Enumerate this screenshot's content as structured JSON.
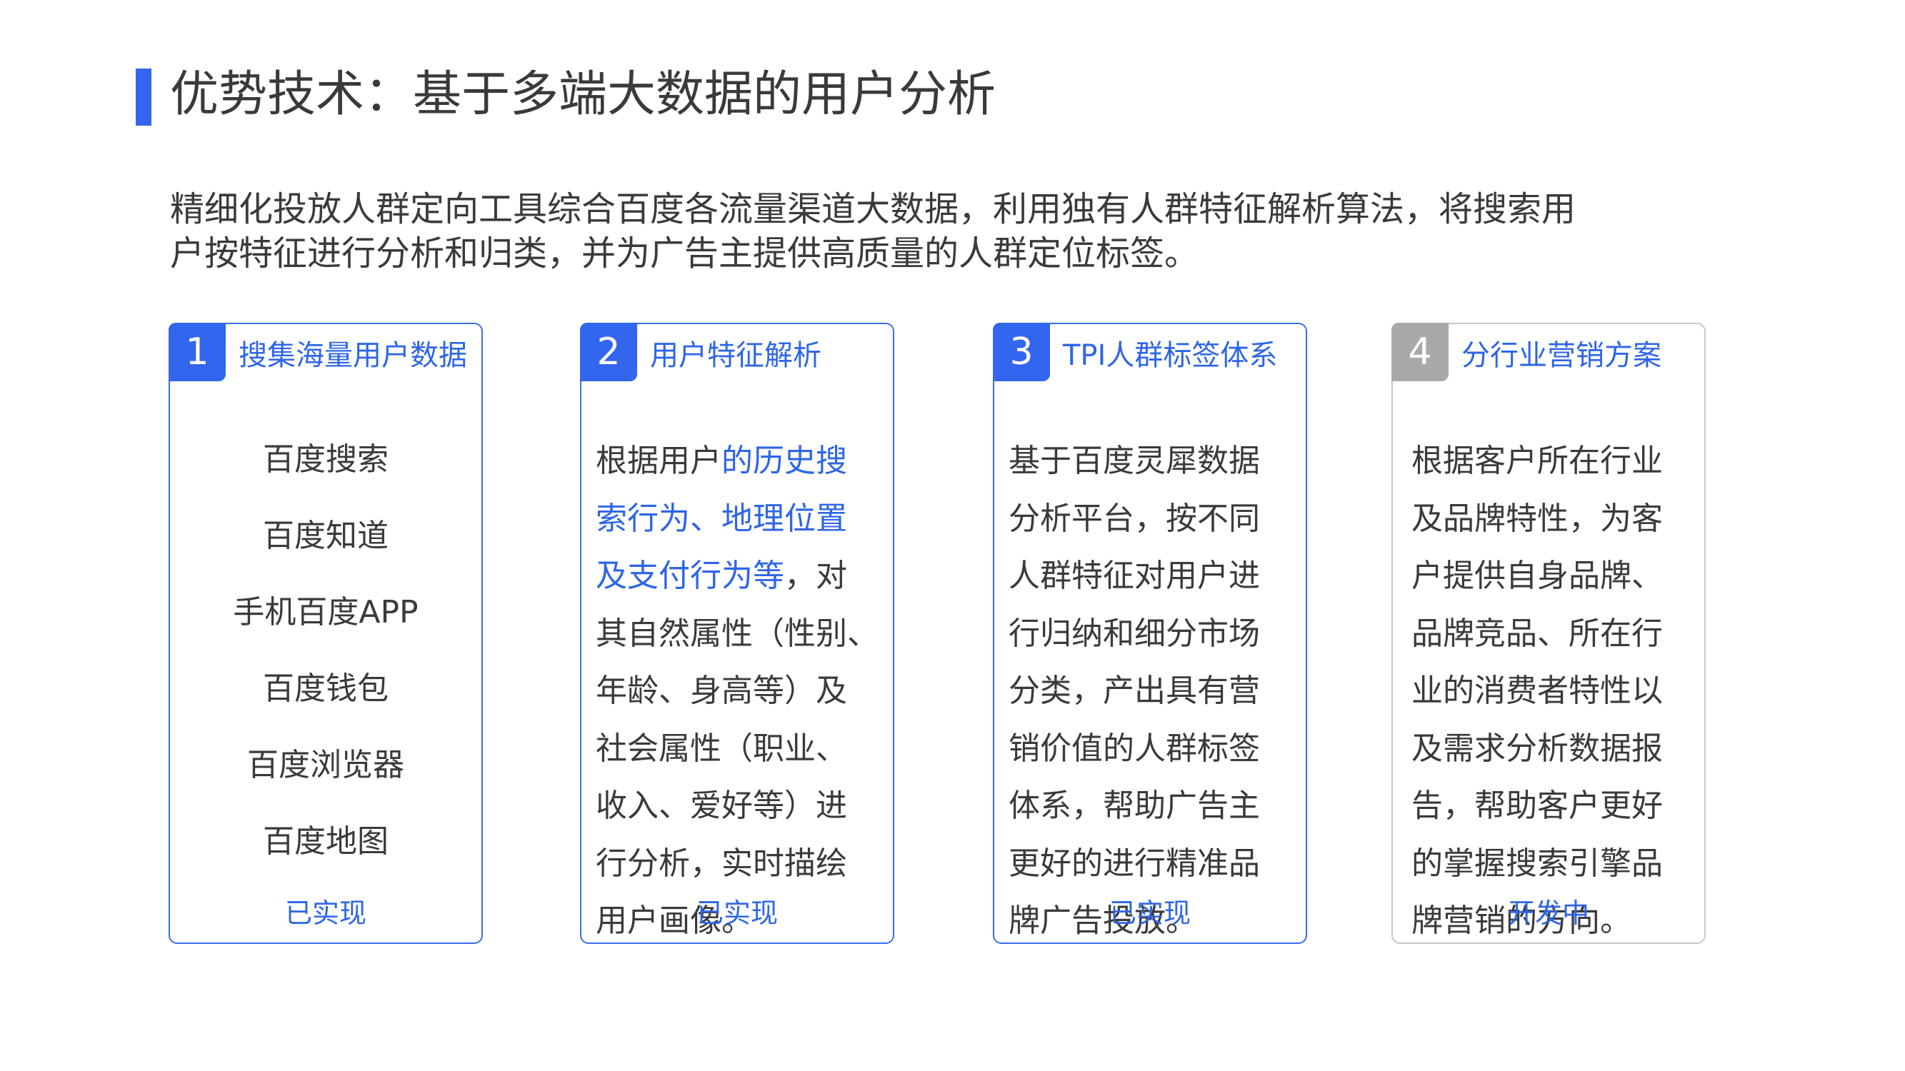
{
  "title": "优势技术：基于多端大数据的用户分析",
  "intro": {
    "line1": "精细化投放人群定向工具综合百度各流量渠道大数据，利用独有人群特征解析算法，将搜索用",
    "line2": "户按特征进行分析和归类，并为广告主提供高质量的人群定位标签。"
  },
  "cards": [
    {
      "number": "1",
      "heading": "搜集海量用户数据",
      "items": [
        "百度搜索",
        "百度知道",
        "手机百度APP",
        "百度钱包",
        "百度浏览器",
        "百度地图"
      ],
      "status": "已实现"
    },
    {
      "number": "2",
      "heading": "用户特征解析",
      "body": {
        "lead": "根据用户",
        "highlight": "的历史搜索行为、地理位置及支付行为等",
        "rest": "，对其自然属性（性别、年龄、身高等）及社会属性（职业、收入、爱好等）进行分析，实时描绘用户画像。",
        "lines": [
          {
            "t": "根据用户"
          },
          {
            "h": "的历史搜"
          },
          {
            "h": "索行为、地理位置"
          },
          {
            "h": "及支付行为等"
          },
          {
            "t": "，对"
          },
          {
            "t": "其自然属性（性别、"
          },
          {
            "t": "年龄、身高等）及"
          },
          {
            "t": "社会属性（职业、"
          },
          {
            "t": "收入、爱好等）进"
          },
          {
            "t": "行分析，实时描绘"
          },
          {
            "t": "用户画像。"
          }
        ]
      },
      "status": "已实现"
    },
    {
      "number": "3",
      "heading": "TPI人群标签体系",
      "body": {
        "lines": [
          "基于百度灵犀数据",
          "分析平台，按不同",
          "人群特征对用户进",
          "行归纳和细分市场",
          "分类，产出具有营",
          "销价值的人群标签",
          "体系，帮助广告主",
          "更好的进行精准品",
          "牌广告投放。"
        ]
      },
      "status": "已实现"
    },
    {
      "number": "4",
      "heading": "分行业营销方案",
      "body": {
        "lines": [
          "根据客户所在行业",
          "及品牌特性，为客",
          "户提供自身品牌、",
          "品牌竞品、所在行",
          "业的消费者特性以",
          "及需求分析数据报",
          "告，帮助客户更好",
          "的掌握搜索引擎品",
          "牌营销的方向。"
        ]
      },
      "status": "开发中"
    }
  ],
  "colors": {
    "accent": "#3366ee",
    "text": "#3a3a3a",
    "inactive": "#a9a9a9"
  }
}
